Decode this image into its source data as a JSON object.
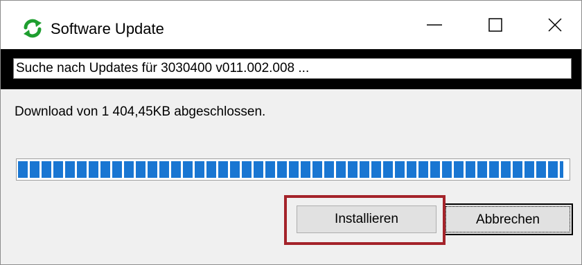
{
  "window": {
    "title": "Software Update",
    "icon": "green-refresh-icon",
    "controls": [
      "minimize",
      "maximize",
      "close"
    ]
  },
  "status": {
    "text": "Suche nach Updates für 3030400 v011.002.008 ..."
  },
  "download": {
    "message": "Download von 1 404,45KB abgeschlossen."
  },
  "progress": {
    "percent": 100,
    "color": "#1976d2"
  },
  "buttons": {
    "install_label": "Installieren",
    "cancel_label": "Abbrechen"
  },
  "highlight": {
    "color": "#a4232a",
    "target": "install-button"
  }
}
